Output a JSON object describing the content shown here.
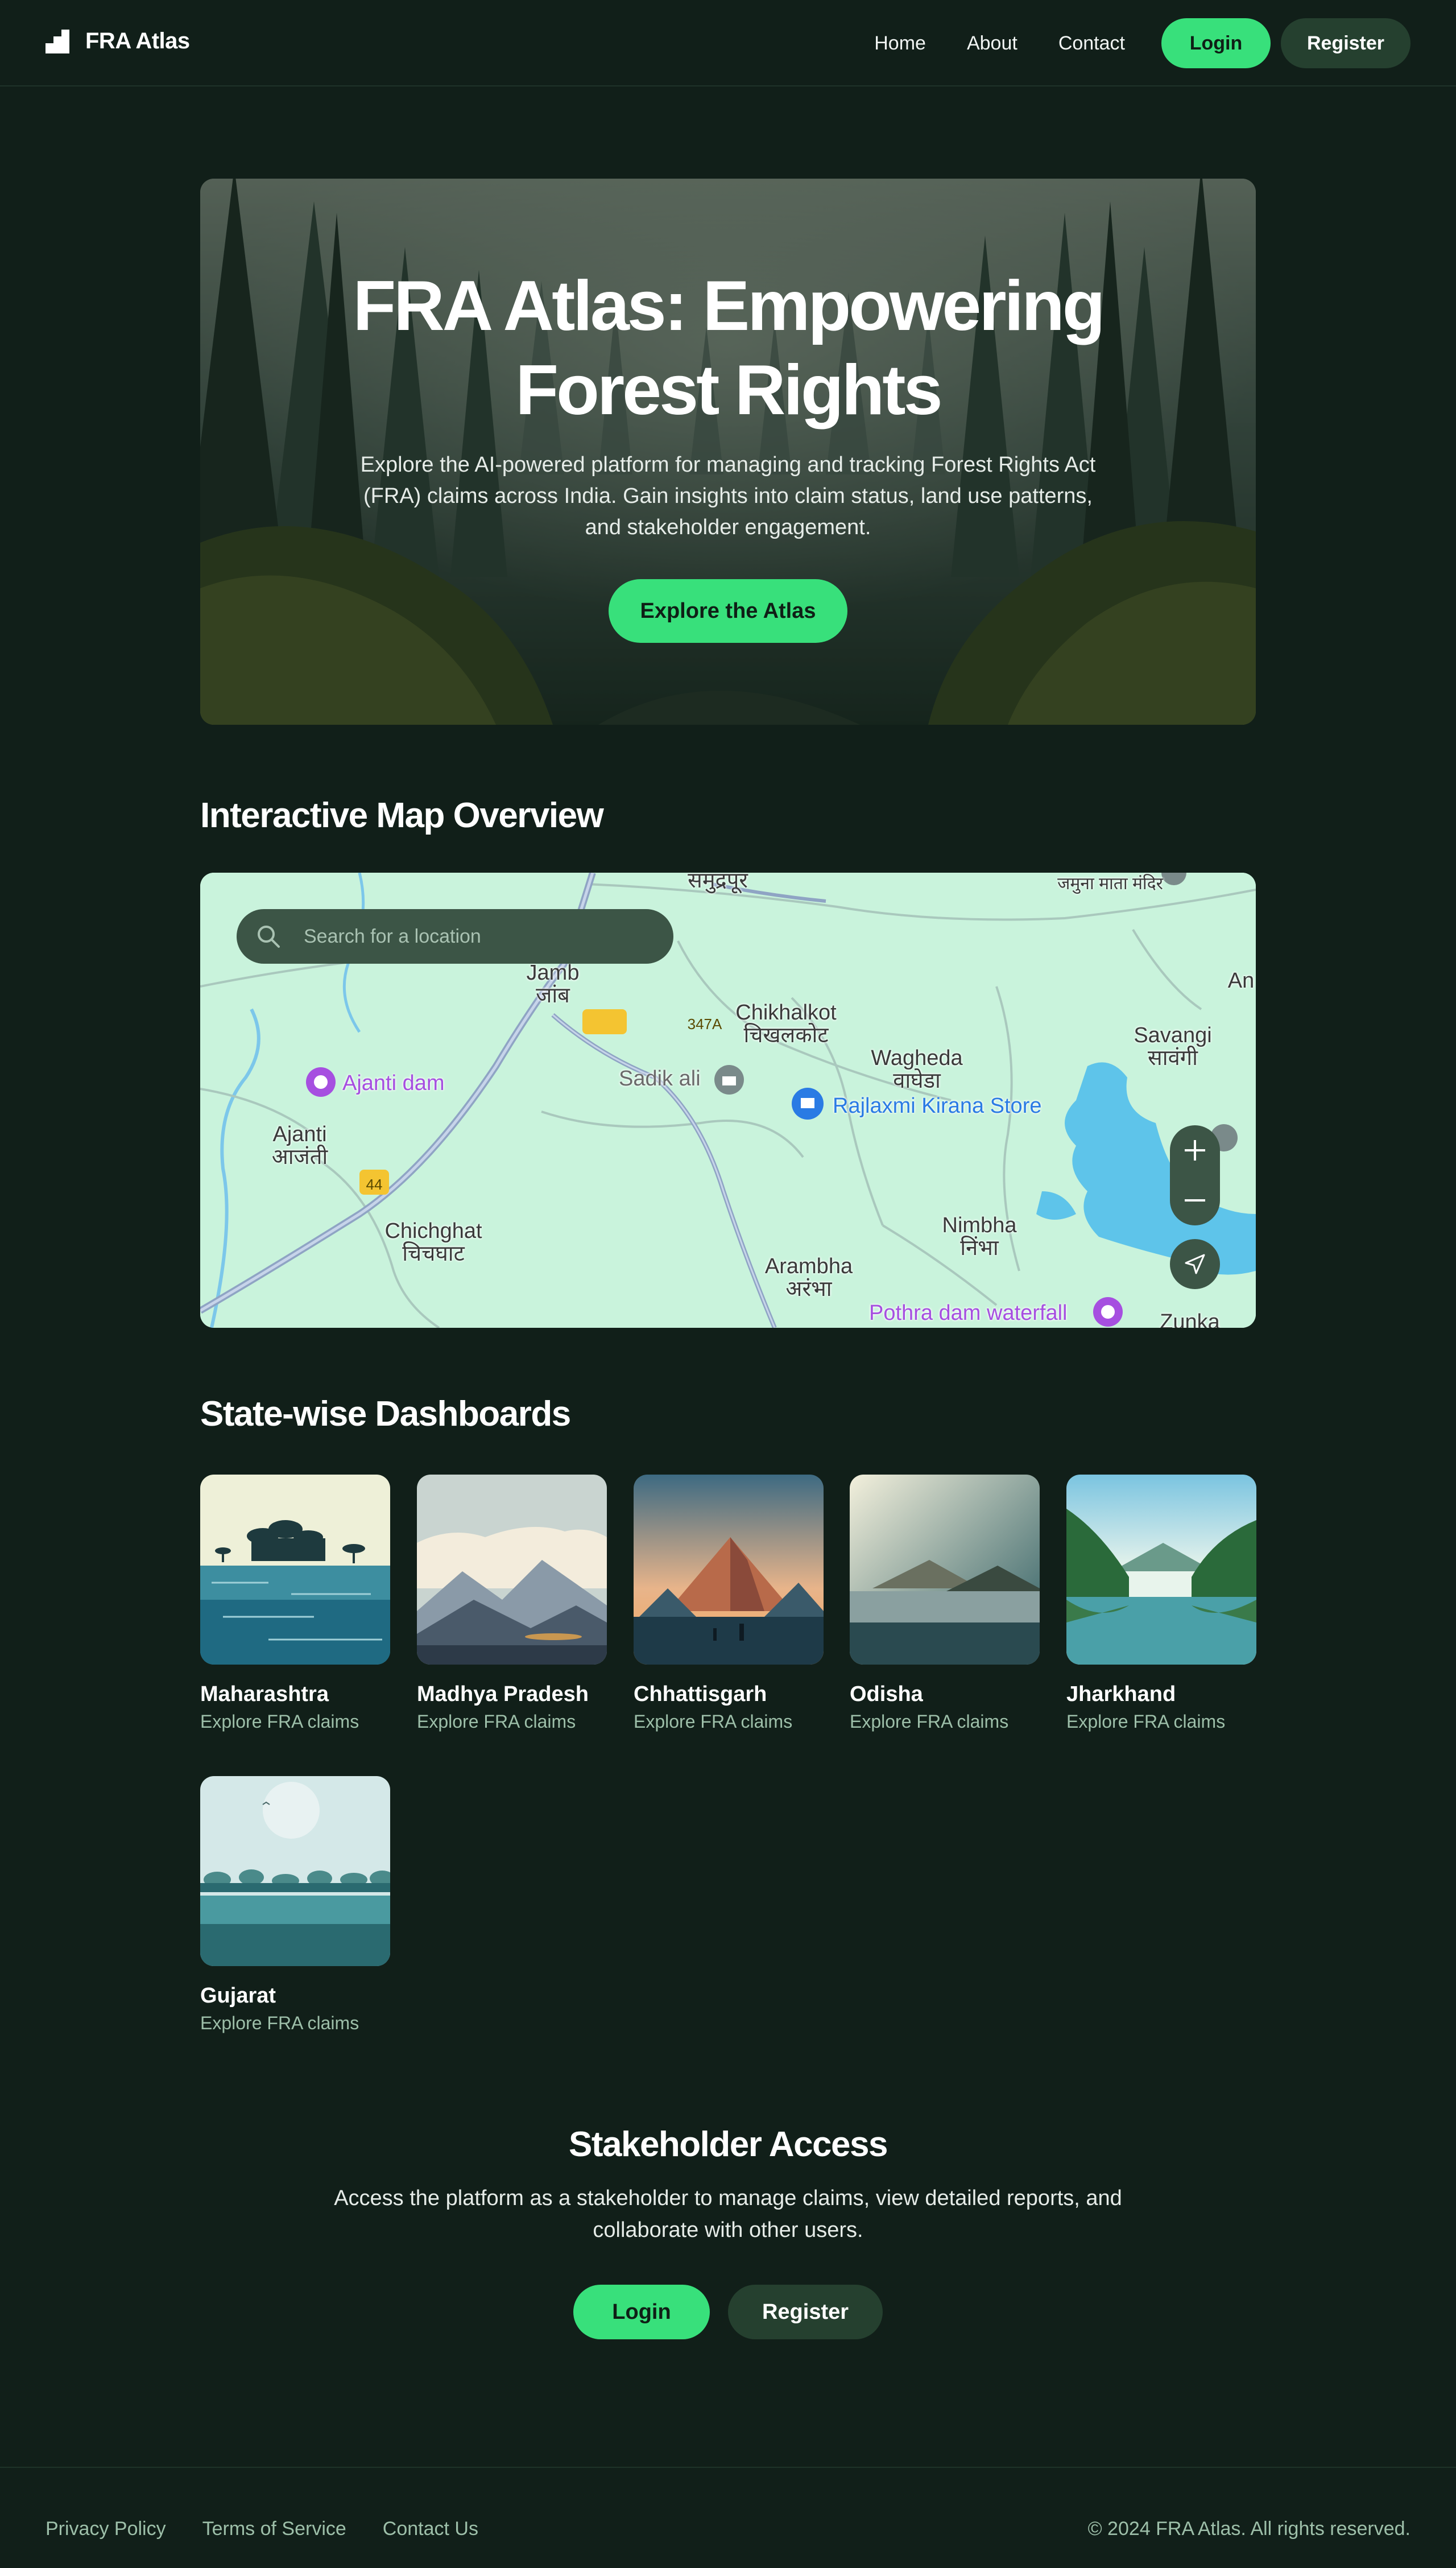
{
  "header": {
    "brand": "FRA Atlas",
    "nav": [
      "Home",
      "About",
      "Contact"
    ],
    "login": "Login",
    "register": "Register"
  },
  "hero": {
    "title_line1": "FRA Atlas: Empowering",
    "title_line2": "Forest Rights",
    "subtitle": "Explore the AI-powered platform for managing and tracking Forest Rights Act (FRA) claims across India. Gain insights into claim status, land use patterns, and stakeholder engagement.",
    "cta": "Explore the Atlas"
  },
  "map_section": {
    "title": "Interactive Map Overview",
    "search_placeholder": "Search for a location",
    "labels": {
      "jamb": "Jamb",
      "jamb_local": "जांब",
      "samudrapur": "समुद्रपूर",
      "jamuna_mata": "जमुना माता मंदिर",
      "chikhalkot": "Chikhalkot",
      "chikhalkot_local": "चिखलकोट",
      "wagheda": "Wagheda",
      "wagheda_local": "वाघेडा",
      "savangi": "Savangi",
      "savangi_local": "सावंगी",
      "an": "An",
      "ajanti": "Ajanti",
      "ajanti_local": "आजंती",
      "chichghat": "Chichghat",
      "chichghat_local": "चिचघाट",
      "nimbha": "Nimbha",
      "nimbha_local": "निंभा",
      "arambha": "Arambha",
      "arambha_local": "अरंभा",
      "zunka": "Zunka",
      "sadik_ali": "Sadik ali",
      "ajanti_dam": "Ajanti dam",
      "rajlaxmi": "Rajlaxmi Kirana Store",
      "pothra": "Pothra dam waterfall",
      "road_347a": "347A",
      "road_44": "44"
    }
  },
  "states_section": {
    "title": "State-wise Dashboards",
    "cards": [
      {
        "name": "Maharashtra",
        "sub": "Explore FRA claims"
      },
      {
        "name": "Madhya Pradesh",
        "sub": "Explore FRA claims"
      },
      {
        "name": "Chhattisgarh",
        "sub": "Explore FRA claims"
      },
      {
        "name": "Odisha",
        "sub": "Explore FRA claims"
      },
      {
        "name": "Jharkhand",
        "sub": "Explore FRA claims"
      },
      {
        "name": "Gujarat",
        "sub": "Explore FRA claims"
      }
    ]
  },
  "stakeholder": {
    "title": "Stakeholder Access",
    "subtitle": "Access the platform as a stakeholder to manage claims, view detailed reports, and collaborate with other users.",
    "login": "Login",
    "register": "Register"
  },
  "footer": {
    "links": [
      "Privacy Policy",
      "Terms of Service",
      "Contact Us"
    ],
    "copyright": "© 2024 FRA Atlas. All rights reserved."
  },
  "colors": {
    "background": "#111f19",
    "accent": "#38e07b",
    "secondary_button": "#25402f",
    "muted_text": "#9dbfa9"
  }
}
